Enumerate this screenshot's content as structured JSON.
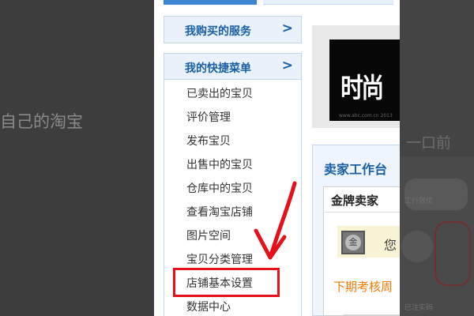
{
  "backdrop": {
    "left_text": "自己的淘宝",
    "right_heading": "一口前",
    "right_small_a": "工行效优",
    "right_small_b": "已注实码"
  },
  "sidebar": {
    "services_label": "我购买的服务",
    "shortcut_label": "我的快捷菜单",
    "arrow": ">",
    "menu_items": [
      "已卖出的宝贝",
      "评价管理",
      "发布宝贝",
      "出售中的宝贝",
      "仓库中的宝贝",
      "查看淘宝店铺",
      "图片空间",
      "宝贝分类管理",
      "店铺基本设置",
      "数据中心"
    ]
  },
  "content": {
    "thumb_logo": "时尚",
    "thumb_caption": "www.abc.com.cn 2013",
    "workbench_title": "卖家工作台",
    "gold_title": "金牌卖家",
    "medal_glyph": "金",
    "medal_text": "您",
    "next_review": "下期考核周"
  },
  "colors": {
    "accent_blue": "#1a5fa6",
    "highlight_red": "#e4111a",
    "orange_text": "#ef7b00"
  }
}
